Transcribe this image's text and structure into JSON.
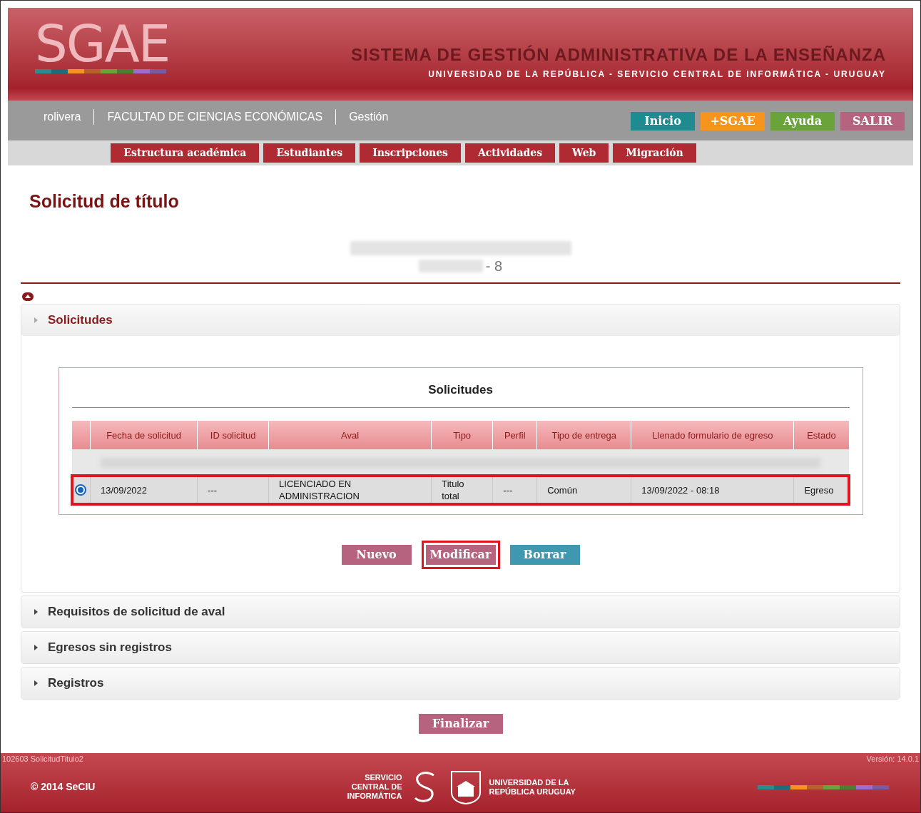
{
  "header": {
    "logo": "SGAE",
    "title": "SISTEMA DE GESTIÓN ADMINISTRATIVA DE LA ENSEÑANZA",
    "subtitle": "UNIVERSIDAD DE LA REPÚBLICA - SERVICIO CENTRAL DE INFORMÁTICA - URUGUAY"
  },
  "user_bar": {
    "items": [
      "rolivera",
      "FACULTAD DE CIENCIAS ECONÓMICAS",
      "Gestión"
    ],
    "buttons": [
      {
        "label": "Inicio",
        "color": "#1f8a8f"
      },
      {
        "label": "+SGAE",
        "color": "#f7941d"
      },
      {
        "label": "Ayuda",
        "color": "#6aa33a"
      },
      {
        "label": "SALIR",
        "color": "#b5637e"
      }
    ]
  },
  "nav": [
    "Estructura académica",
    "Estudiantes",
    "Inscripciones",
    "Actividades",
    "Web",
    "Migración"
  ],
  "page_title": "Solicitud de título",
  "student": {
    "suffix": "- 8"
  },
  "sections": [
    {
      "title": "Solicitudes",
      "expanded": true
    },
    {
      "title": "Requisitos de solicitud de aval",
      "expanded": false
    },
    {
      "title": "Egresos sin registros",
      "expanded": false
    },
    {
      "title": "Registros",
      "expanded": false
    }
  ],
  "table": {
    "caption": "Solicitudes",
    "columns": [
      "Fecha de solicitud",
      "ID solicitud",
      "Aval",
      "Tipo",
      "Perfil",
      "Tipo de entrega",
      "Llenado formulario de egreso",
      "Estado"
    ],
    "rows": [
      {
        "kind": "redacted"
      },
      {
        "kind": "data",
        "selected": true,
        "highlighted": true,
        "cells": [
          "13/09/2022",
          "---",
          "LICENCIADO EN ADMINISTRACION",
          "Titulo total",
          "---",
          "Común",
          "13/09/2022 - 08:18",
          "Egreso"
        ]
      }
    ]
  },
  "actions": [
    {
      "label": "Nuevo",
      "color": "#b5637e",
      "highlighted": false
    },
    {
      "label": "Modificar",
      "color": "#b5637e",
      "highlighted": true
    },
    {
      "label": "Borrar",
      "color": "#3f97b0",
      "highlighted": false
    }
  ],
  "finish": {
    "label": "Finalizar"
  },
  "footer": {
    "page_id": "102603 SolicitudTitulo2",
    "version": "Versión: 14.0.1",
    "copyright": "© 2014 SeCIU",
    "left_org": "SERVICIO CENTRAL DE INFORMÁTICA",
    "right_org": "UNIVERSIDAD DE LA REPÚBLICA URUGUAY"
  }
}
